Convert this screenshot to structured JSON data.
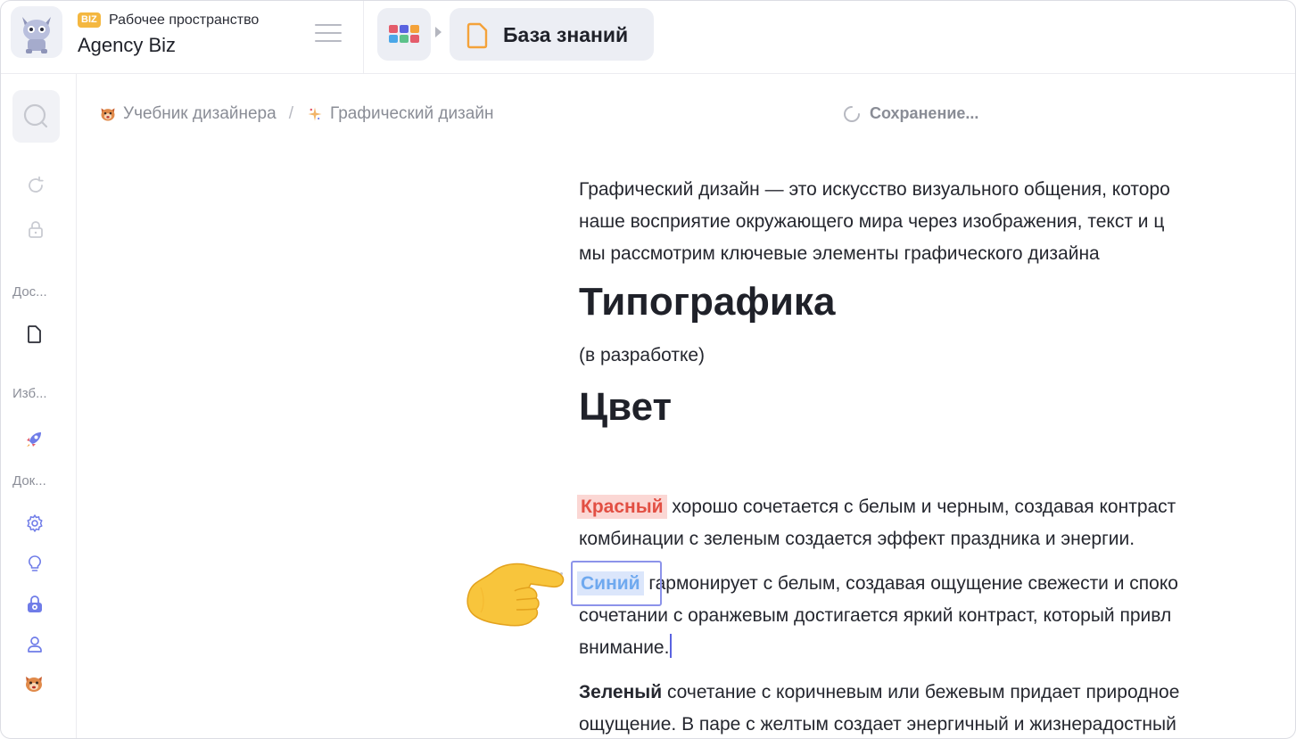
{
  "workspace": {
    "badge": "BIZ",
    "subtitle": "Рабочее пространство",
    "name": "Agency Biz",
    "avatar": "cat-avatar-icon"
  },
  "nav": {
    "apps_icon": "apps-grid-icon",
    "current_section": "База знаний",
    "apps_colors": [
      "#e45c6b",
      "#5a63e0",
      "#f4a23a",
      "#4aa7e8",
      "#5cc28a",
      "#e45c6b"
    ]
  },
  "sidebar": {
    "sections": [
      {
        "label": "Дос...",
        "items": [
          "document-icon"
        ]
      },
      {
        "label": "Изб...",
        "items": [
          "rocket-icon"
        ]
      },
      {
        "label": "Док...",
        "items": [
          "gear-icon",
          "lightbulb-icon",
          "lock-badge-icon",
          "user-icon",
          "cat-face-icon"
        ]
      }
    ],
    "top_icons": [
      "search-icon",
      "refresh-icon",
      "lock-icon"
    ]
  },
  "breadcrumb": {
    "items": [
      "Учебник дизайнера",
      "Графический дизайн"
    ],
    "separator": "/"
  },
  "status": {
    "text": "Сохранение..."
  },
  "document": {
    "intro": [
      "Графический дизайн — это искусство визуального общения, которо",
      "наше восприятие окружающего мира через изображения, текст и ц",
      "мы рассмотрим ключевые элементы графического дизайна"
    ],
    "h_typography": "Типографика",
    "typography_note": "(в разработке)",
    "h_color": "Цвет",
    "red": {
      "word": "Красный",
      "rest_line1": " хорошо сочетается с белым и черным, создавая контраст",
      "line2": "комбинации с зеленым создается эффект праздника и энергии."
    },
    "blue": {
      "word": "Синий",
      "rest_line1": " гармонирует с белым, создавая ощущение свежести и споко",
      "line2": "сочетании с оранжевым достигается яркий контраст, который привл",
      "line3": "внимание."
    },
    "green": {
      "word": "Зеленый",
      "rest_line1": " сочетание с коричневым или бежевым придает природное",
      "line2": "ощущение. В паре с желтым создает энергичный и жизнерадостный"
    }
  },
  "colors": {
    "red_highlight": "#fbd7d4",
    "red_text": "#e24f43",
    "blue_highlight": "#dbe6fb",
    "blue_text": "#6fa9ef",
    "accent": "#5a63e0"
  },
  "overlay": {
    "pointer": "pointing-hand-emoji-icon"
  }
}
